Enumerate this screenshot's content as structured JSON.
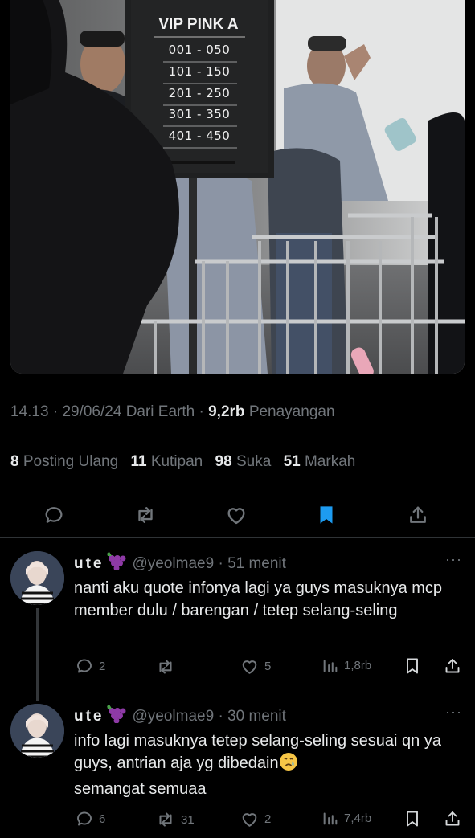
{
  "photo": {
    "sign_title": "VIP PINK A",
    "sign_rows": [
      "001  -  050",
      "101  -  150",
      "201  -  250",
      "301  -  350",
      "401  -  450"
    ]
  },
  "tweet_meta": {
    "time": "14.13",
    "date": "29/06/24",
    "source": "Dari Earth",
    "views_count": "9,2rb",
    "views_label": "Penayangan"
  },
  "tweet_stats": {
    "reposts_count": "8",
    "reposts_label": "Posting Ulang",
    "quotes_count": "11",
    "quotes_label": "Kutipan",
    "likes_count": "98",
    "likes_label": "Suka",
    "bookmarks_count": "51",
    "bookmarks_label": "Markah"
  },
  "colors": {
    "accent": "#1d9bf0",
    "muted": "#71767b",
    "text": "#e7e9ea",
    "background": "#000000"
  },
  "icons": {
    "reply": "speech-bubble-icon",
    "repost": "repost-arrows-icon",
    "like": "heart-icon",
    "bookmark": "bookmark-icon",
    "share": "share-icon",
    "views": "bar-chart-icon",
    "more": "more-dots-icon",
    "name_emoji": "grapes-emoji",
    "text_emoji": "crying-face-emoji"
  },
  "replies": [
    {
      "name": "ute",
      "handle": "@yeolmae9",
      "time": "51 menit",
      "more": "···",
      "text": "nanti aku quote infonya lagi ya guys masuknya mcp member dulu / barengan / tetep selang-seling",
      "reply_count": "2",
      "repost_count": "",
      "like_count": "5",
      "views": "1,8rb"
    },
    {
      "name": "ute",
      "handle": "@yeolmae9",
      "time": "30 menit",
      "more": "···",
      "text_before": "info lagi masuknya tetep selang-seling sesuai qn ya guys, antrian aja yg dibedain",
      "text_after": "semangat semuaa",
      "reply_count": "6",
      "repost_count": "31",
      "like_count": "2",
      "views": "7,4rb"
    }
  ]
}
